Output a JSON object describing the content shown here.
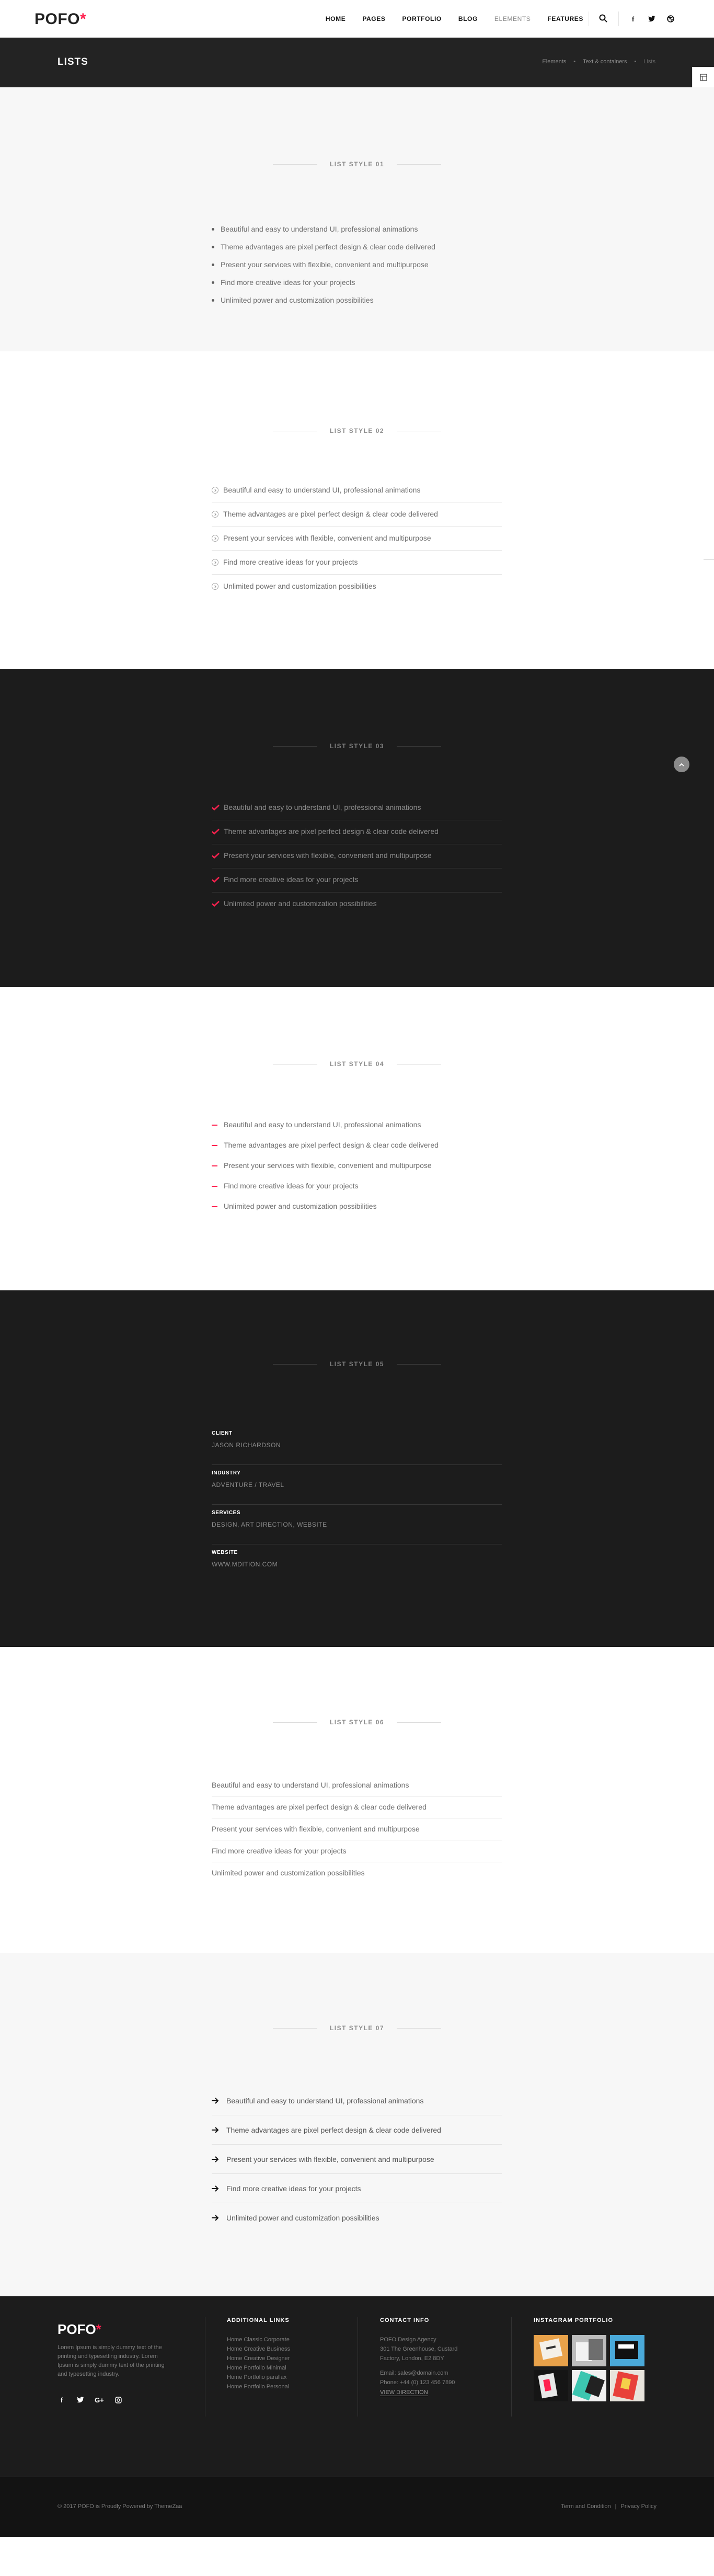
{
  "header": {
    "logo_text": "POFO",
    "logo_mark": "*",
    "nav": [
      "HOME",
      "PAGES",
      "PORTFOLIO",
      "BLOG",
      "ELEMENTS",
      "FEATURES"
    ],
    "active_nav": "ELEMENTS",
    "icons": [
      "search-icon",
      "facebook-icon",
      "twitter-icon",
      "dribbble-icon"
    ]
  },
  "page_title": {
    "title": "LISTS",
    "breadcrumb": [
      "Elements",
      "Text & containers",
      "Lists"
    ]
  },
  "side_buttons": [
    "layout-icon",
    "mail-icon"
  ],
  "lists": {
    "style01": {
      "title": "LIST STYLE 01",
      "items": [
        "Beautiful and easy to understand UI, professional animations",
        "Theme advantages are pixel perfect design & clear code delivered",
        "Present your services with flexible, convenient and multipurpose",
        "Find more creative ideas for your projects",
        "Unlimited power and customization possibilities"
      ]
    },
    "style02": {
      "title": "LIST STYLE 02",
      "items": [
        "Beautiful and easy to understand UI, professional animations",
        "Theme advantages are pixel perfect design & clear code delivered",
        "Present your services with flexible, convenient and multipurpose",
        "Find more creative ideas for your projects",
        "Unlimited power and customization possibilities"
      ]
    },
    "style03": {
      "title": "LIST STYLE 03",
      "items": [
        "Beautiful and easy to understand UI, professional animations",
        "Theme advantages are pixel perfect design & clear code delivered",
        "Present your services with flexible, convenient and multipurpose",
        "Find more creative ideas for your projects",
        "Unlimited power and customization possibilities"
      ]
    },
    "style04": {
      "title": "LIST STYLE 04",
      "items": [
        "Beautiful and easy to understand UI, professional animations",
        "Theme advantages are pixel perfect design & clear code delivered",
        "Present your services with flexible, convenient and multipurpose",
        "Find more creative ideas for your projects",
        "Unlimited power and customization possibilities"
      ]
    },
    "style05": {
      "title": "LIST STYLE 05",
      "items": [
        {
          "label": "CLIENT",
          "value": "JASON RICHARDSON"
        },
        {
          "label": "INDUSTRY",
          "value": "ADVENTURE / TRAVEL"
        },
        {
          "label": "SERVICES",
          "value": "DESIGN, ART DIRECTION, WEBSITE"
        },
        {
          "label": "WEBSITE",
          "value": "WWW.MDITION.COM"
        }
      ]
    },
    "style06": {
      "title": "LIST STYLE 06",
      "items": [
        "Beautiful and easy to understand UI, professional animations",
        "Theme advantages are pixel perfect design & clear code delivered",
        "Present your services with flexible, convenient and multipurpose",
        "Find more creative ideas for your projects",
        "Unlimited power and customization possibilities"
      ]
    },
    "style07": {
      "title": "LIST STYLE 07",
      "items": [
        "Beautiful and easy to understand UI, professional animations",
        "Theme advantages are pixel perfect design & clear code delivered",
        "Present your services with flexible, convenient and multipurpose",
        "Find more creative ideas for your projects",
        "Unlimited power and customization possibilities"
      ]
    }
  },
  "footer": {
    "logo_text": "POFO",
    "logo_mark": "*",
    "about": "Lorem Ipsum is simply dummy text of the printing and typesetting industry. Lorem Ipsum is simply dummy text of the printing and typesetting industry.",
    "social": [
      "facebook-icon",
      "twitter-icon",
      "google-plus-icon",
      "instagram-icon"
    ],
    "additional_links": {
      "title": "ADDITIONAL LINKS",
      "items": [
        "Home Classic Corporate",
        "Home Creative Business",
        "Home Creative Designer",
        "Home Portfolio Minimal",
        "Home Portfolio parallax",
        "Home Portfolio Personal"
      ]
    },
    "contact": {
      "title": "CONTACT INFO",
      "address": [
        "POFO Design Agency",
        "301 The Greenhouse, Custard",
        "Factory, London, E2 8DY"
      ],
      "email": "Email: sales@domain.com",
      "phone": "Phone: +44 (0) 123 456 7890",
      "directions": "VIEW DIRECTION"
    },
    "instagram": {
      "title": "INSTAGRAM PORTFOLIO"
    },
    "copyright": "© 2017 POFO is Proudly Powered by ThemeZaa",
    "legal": [
      "Term and Condition",
      "|",
      "Privacy Policy"
    ]
  },
  "colors": {
    "accent": "#ff214f",
    "dark_bg": "#1c1c1c",
    "title_bar_bg": "#232323",
    "light_bg": "#f7f7f7"
  }
}
